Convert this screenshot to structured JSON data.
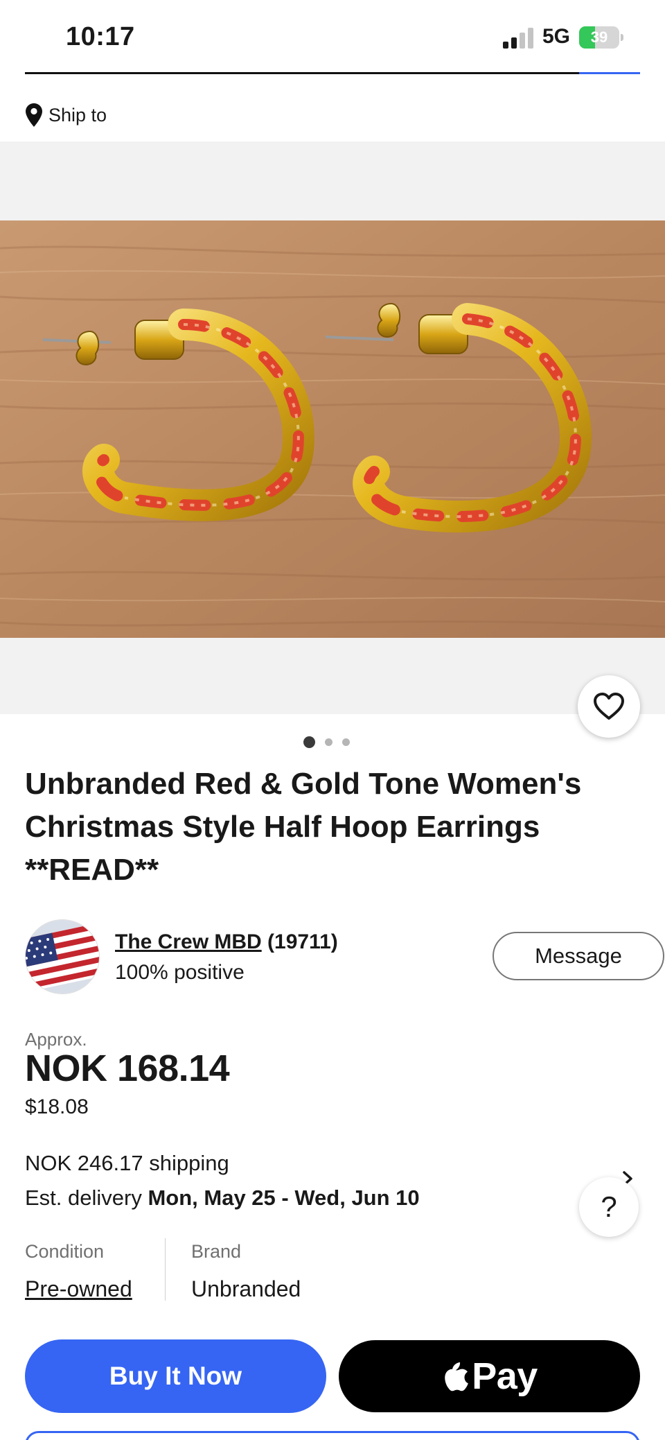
{
  "status_bar": {
    "time": "10:17",
    "network": "5G",
    "battery_percent": "39",
    "battery_level": 0.39,
    "battery_color": "#34c759"
  },
  "ship_to": {
    "label": "Ship to",
    "icon": "location-pin-icon"
  },
  "gallery": {
    "image_alt": "Red and gold twisted half hoop earrings on wood surface",
    "total_images": 3,
    "active_index": 0,
    "watch_icon": "heart-icon"
  },
  "listing": {
    "title": "Unbranded Red & Gold Tone Women's Christmas Style Half Hoop Earrings **READ**"
  },
  "seller": {
    "name": "The Crew MBD",
    "feedback_count": "(19711)",
    "positive": "100% positive",
    "avatar": "us-flag-avatar",
    "message_label": "Message"
  },
  "price": {
    "approx_label": "Approx.",
    "amount": "NOK 168.14",
    "usd": "$18.08"
  },
  "shipping": {
    "cost": "NOK 246.17 shipping",
    "delivery_label": "Est. delivery",
    "delivery_dates": "Mon, May 25 - Wed, Jun 10"
  },
  "help": {
    "label": "?"
  },
  "specs": {
    "condition_label": "Condition",
    "condition_value": "Pre-owned",
    "brand_label": "Brand",
    "brand_value": "Unbranded"
  },
  "actions": {
    "buy_now": "Buy It Now",
    "apple_pay": "Pay",
    "accent_color": "#3665f3"
  }
}
